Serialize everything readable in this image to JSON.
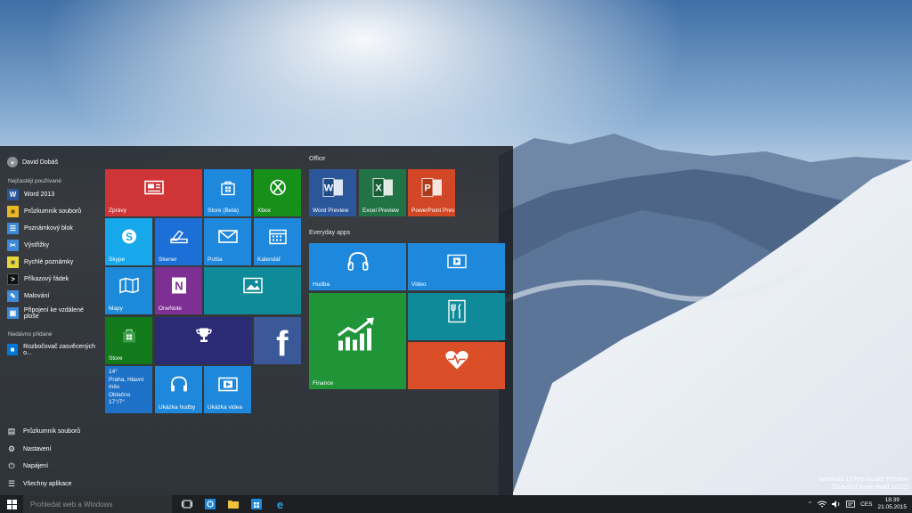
{
  "desktop": {
    "watermark_line1": "Windows 10 Pro Insider Preview",
    "watermark_line2": "Zkušební kopie Build 10122"
  },
  "start_menu": {
    "user_name": "David Dobáš",
    "most_used_label": "Nejčastěji používané",
    "most_used": [
      {
        "label": "Word 2013",
        "icon": "word-icon",
        "color": "#2b579a"
      },
      {
        "label": "Průzkumník souborů",
        "icon": "folder-icon",
        "color": "#e8b825"
      },
      {
        "label": "Poznámkový blok",
        "icon": "notepad-icon",
        "color": "#3d8ad6"
      },
      {
        "label": "Výstřižky",
        "icon": "scissors-icon",
        "color": "#3d8ad6"
      },
      {
        "label": "Rychlé poznámky",
        "icon": "sticky-notes-icon",
        "color": "#e6d63a"
      },
      {
        "label": "Příkazový řádek",
        "icon": "command-prompt-icon",
        "color": "#111111"
      },
      {
        "label": "Malování",
        "icon": "paint-icon",
        "color": "#3d8ad6"
      },
      {
        "label": "Připojení ke vzdálené ploše",
        "icon": "remote-desktop-icon",
        "color": "#3d8ad6"
      }
    ],
    "recent_label": "Nedávno přidané",
    "recent": [
      {
        "label": "Rozbočovač zasvěcených o...",
        "icon": "insider-hub-icon",
        "color": "#0078d7"
      }
    ],
    "bottom": [
      {
        "label": "Průzkumník souborů",
        "icon": "explorer-icon"
      },
      {
        "label": "Nastavení",
        "icon": "settings-gear-icon"
      },
      {
        "label": "Napájení",
        "icon": "power-icon"
      },
      {
        "label": "Všechny aplikace",
        "icon": "all-apps-icon"
      }
    ],
    "tiles": {
      "zpravy": "Zprávy",
      "store_beta": "Store (Beta)",
      "xbox": "Xbox",
      "skype": "Skype",
      "skener": "Skener",
      "posta": "Pošta",
      "kalendar": "Kalendář",
      "mapy": "Mapy",
      "onenote": "OneNote",
      "store": "Store",
      "weather_temp": "14°",
      "weather_city": "Praha, Hlavní měs",
      "weather_cond": "Oblačno",
      "weather_range": "17°/7°",
      "ukazka_hudby": "Ukázka hudby",
      "ukazka_videa": "Ukázka videa"
    },
    "office_group": {
      "title": "Office",
      "word": "Word Preview",
      "excel": "Excel Preview",
      "powerpoint": "PowerPoint Prev"
    },
    "everyday_group": {
      "title": "Everyday apps",
      "hudba": "Hudba",
      "video": "Video",
      "finance": "Finance"
    }
  },
  "taskbar": {
    "search_placeholder": "Prohledat web a Windows",
    "language": "CES",
    "time": "18:39",
    "date": "21.05.2015"
  }
}
